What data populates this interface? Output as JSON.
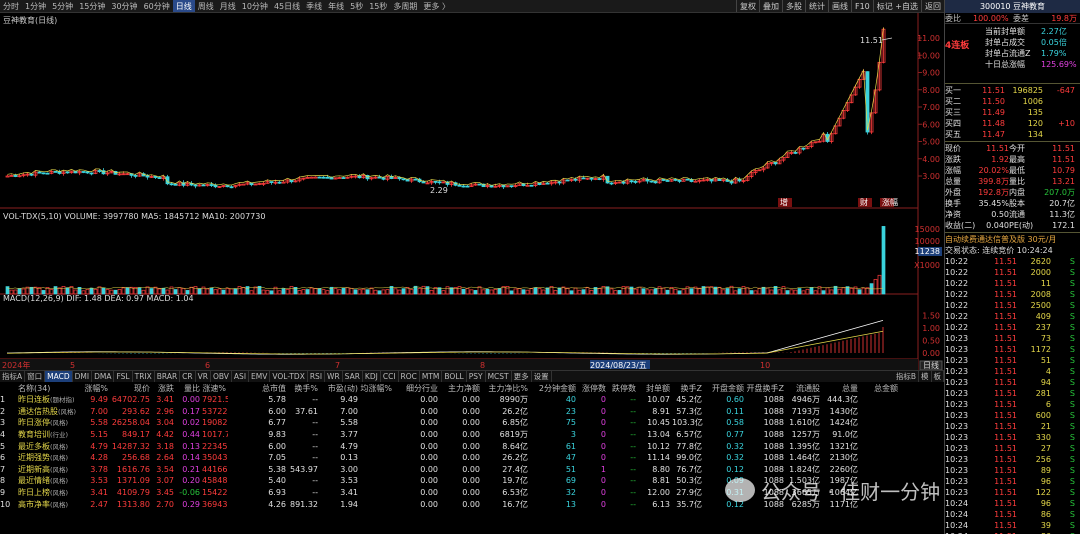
{
  "topbar": {
    "periods": [
      "分时",
      "1分钟",
      "5分钟",
      "15分钟",
      "30分钟",
      "60分钟",
      "日线",
      "周线",
      "月线",
      "10分钟",
      "45日线",
      "季线",
      "年线",
      "5秒",
      "15秒",
      "多周期",
      "更多 〉"
    ],
    "selected": "日线",
    "right": [
      "复权",
      "叠加",
      "多股",
      "统计",
      "画线",
      "F10",
      "标记 +自选",
      "返回"
    ]
  },
  "chart": {
    "title": "豆神教育(日线)",
    "price_axis": [
      "11.00",
      "10.00",
      "9.00",
      "8.00",
      "7.00",
      "6.00",
      "5.00",
      "4.00",
      "3.00"
    ],
    "high_label": "11.51",
    "low_label": "2.29",
    "markers": [
      "增",
      "财",
      "涨幅"
    ],
    "vol_title": "VOL-TDX(5,10) VOLUME: 3997780 MA5: 1845712 MA10: 2007730",
    "vol_axis": [
      "15000",
      "10000",
      "5000",
      "X1000"
    ],
    "vol_last": "11238",
    "macd_title": "MACD(12,26,9) DIF: 1.48 DEA: 0.97 MACD: 1.04",
    "macd_axis": [
      "1.50",
      "1.00",
      "0.50",
      "0.00"
    ],
    "date_axis": [
      "2024年",
      "5",
      "6",
      "7",
      "8",
      "9",
      "2024/08/23/五",
      "10"
    ],
    "side_tab": "日线"
  },
  "tabs": {
    "items": [
      "指标A",
      "窗口",
      "MACD",
      "DMI",
      "DMA",
      "FSL",
      "TRIX",
      "BRAR",
      "CR",
      "VR",
      "OBV",
      "ASI",
      "EMV",
      "VOL-TDX",
      "RSI",
      "WR",
      "SAR",
      "KDJ",
      "CCI",
      "ROC",
      "MTM",
      "BOLL",
      "PSY",
      "MCST",
      "更多",
      "设置"
    ],
    "selected": "MACD",
    "right": [
      "指标B",
      "模",
      "板"
    ]
  },
  "table": {
    "headers": [
      "",
      "名称(34)",
      "涨幅%",
      "现价",
      "涨跌",
      "量比",
      "涨速%",
      "总市值",
      "换手%",
      "市盈(动)",
      "均涨幅%",
      "细分行业",
      "主力净额",
      "主力净比%",
      "2分钟金额",
      "涨停数",
      "跌停数",
      "封单额",
      "换手Z",
      "开盘金额",
      "开盘换手Z",
      "流通股",
      "总量",
      "总金额"
    ],
    "rows": [
      [
        "1",
        "昨日连板",
        "(题材指)",
        "9.49",
        "64702.75",
        "3.41",
        "0.00",
        "7921.56亿",
        "5.78",
        "--",
        "9.49",
        "",
        "0.00",
        "0.00",
        "8990万",
        "40",
        "0",
        "--",
        "10.07",
        "45.2亿",
        "0.60",
        "1088",
        "4946万",
        "444.3亿"
      ],
      [
        "2",
        "通达信热股",
        "(风格)",
        "7.00",
        "293.62",
        "2.96",
        "0.17",
        "53722.25亿",
        "6.00",
        "37.61",
        "7.00",
        "",
        "0.00",
        "0.00",
        "26.2亿",
        "23",
        "0",
        "--",
        "8.91",
        "57.3亿",
        "0.11",
        "1088",
        "7193万",
        "1430亿"
      ],
      [
        "3",
        "昨日涨停",
        "(风格)",
        "5.58",
        "26258.04",
        "3.04",
        "0.02",
        "19082.38亿",
        "6.77",
        "--",
        "5.58",
        "",
        "0.00",
        "0.00",
        "6.85亿",
        "75",
        "0",
        "--",
        "10.45",
        "103.3亿",
        "0.58",
        "1088",
        "1.610亿",
        "1424亿"
      ],
      [
        "4",
        "教育培训",
        "(行业)",
        "5.15",
        "849.17",
        "4.42",
        "0.44",
        "1017.75亿",
        "9.83",
        "--",
        "3.77",
        "",
        "0.00",
        "0.00",
        "6819万",
        "3",
        "0",
        "--",
        "13.04",
        "6.57亿",
        "0.77",
        "1088",
        "1257万",
        "91.0亿"
      ],
      [
        "5",
        "最近多板",
        "(风格)",
        "4.79",
        "14287.32",
        "3.18",
        "0.13",
        "22345.18亿",
        "6.00",
        "--",
        "4.79",
        "",
        "0.00",
        "0.00",
        "8.64亿",
        "61",
        "0",
        "--",
        "10.12",
        "77.8亿",
        "0.32",
        "1088",
        "1.395亿",
        "1321亿"
      ],
      [
        "6",
        "近期强势",
        "(风格)",
        "4.28",
        "256.68",
        "2.64",
        "0.14",
        "35043.06亿",
        "7.05",
        "--",
        "0.13",
        "",
        "0.00",
        "0.00",
        "26.2亿",
        "47",
        "0",
        "--",
        "11.14",
        "99.0亿",
        "0.32",
        "1088",
        "1.464亿",
        "2130亿"
      ],
      [
        "7",
        "近期新高",
        "(风格)",
        "3.78",
        "1616.76",
        "3.54",
        "0.21",
        "44166.50亿",
        "5.38",
        "543.97",
        "3.00",
        "",
        "0.00",
        "0.00",
        "27.4亿",
        "51",
        "1",
        "--",
        "8.80",
        "76.7亿",
        "0.12",
        "1088",
        "1.824亿",
        "2260亿"
      ],
      [
        "8",
        "最近情绪",
        "(风格)",
        "3.53",
        "1371.09",
        "3.07",
        "0.20",
        "45848.64亿",
        "5.40",
        "--",
        "3.53",
        "",
        "0.00",
        "0.00",
        "19.7亿",
        "69",
        "0",
        "--",
        "8.81",
        "50.3亿",
        "0.09",
        "1088",
        "1.503亿",
        "1987亿"
      ],
      [
        "9",
        "昨日上榜",
        "(风格)",
        "3.41",
        "4109.79",
        "3.45",
        "-0.06",
        "15422.33亿",
        "6.93",
        "--",
        "3.41",
        "",
        "0.00",
        "0.00",
        "6.53亿",
        "32",
        "0",
        "--",
        "12.00",
        "27.9亿",
        "0.31",
        "1088",
        "3665万",
        "1064亿"
      ],
      [
        "10",
        "高市净率",
        "(风格)",
        "2.47",
        "1313.80",
        "2.70",
        "0.29",
        "36943.53亿",
        "4.26",
        "891.32",
        "1.94",
        "",
        "0.00",
        "0.00",
        "16.7亿",
        "13",
        "0",
        "--",
        "6.13",
        "35.7亿",
        "0.12",
        "1088",
        "6285万",
        "1171亿"
      ]
    ]
  },
  "right": {
    "code_name": "300010 豆神教育",
    "weibi_label": "委比",
    "weibi_val": "100.00%",
    "weicha_label": "委差",
    "weicha_val": "19.8万",
    "board": "4连板",
    "seal": [
      [
        "当前封单额",
        "2.27亿"
      ],
      [
        "封单占成交",
        "0.05倍"
      ],
      [
        "封单占流通Z",
        "1.79%"
      ],
      [
        "十日总涨幅",
        "125.69%"
      ]
    ],
    "book": [
      [
        "买一",
        "11.51",
        "196825",
        "-647"
      ],
      [
        "买二",
        "11.50",
        "1006",
        ""
      ],
      [
        "买三",
        "11.49",
        "135",
        ""
      ],
      [
        "买四",
        "11.48",
        "120",
        "+10"
      ],
      [
        "买五",
        "11.47",
        "134",
        ""
      ]
    ],
    "quote": [
      [
        "现价",
        "11.51",
        "今开",
        "11.51"
      ],
      [
        "涨跌",
        "1.92",
        "最高",
        "11.51"
      ],
      [
        "涨幅",
        "20.02%",
        "最低",
        "10.79"
      ],
      [
        "总量",
        "399.8万",
        "量比",
        "13.21"
      ],
      [
        "外盘",
        "192.8万",
        "内盘",
        "207.0万"
      ],
      [
        "换手",
        "35.45%",
        "股本",
        "20.7亿"
      ],
      [
        "净资",
        "0.50",
        "流通",
        "11.3亿"
      ],
      [
        "收益(二)",
        "0.040",
        "PE(动)",
        "172.1"
      ]
    ],
    "auto_line": "自动续费通达信普及版 30元/月",
    "trade_status": "交易状态: 连续竞价 10:24:24",
    "ticks": [
      [
        "10:22",
        "11.51",
        "2620",
        "S"
      ],
      [
        "10:22",
        "11.51",
        "2000",
        "S"
      ],
      [
        "10:22",
        "11.51",
        "11",
        "S"
      ],
      [
        "10:22",
        "11.51",
        "2008",
        "S"
      ],
      [
        "10:22",
        "11.51",
        "2500",
        "S"
      ],
      [
        "10:22",
        "11.51",
        "409",
        "S"
      ],
      [
        "10:22",
        "11.51",
        "237",
        "S"
      ],
      [
        "10:23",
        "11.51",
        "73",
        "S"
      ],
      [
        "10:23",
        "11.51",
        "1172",
        "S"
      ],
      [
        "10:23",
        "11.51",
        "51",
        "S"
      ],
      [
        "10:23",
        "11.51",
        "4",
        "S"
      ],
      [
        "10:23",
        "11.51",
        "94",
        "S"
      ],
      [
        "10:23",
        "11.51",
        "281",
        "S"
      ],
      [
        "10:23",
        "11.51",
        "6",
        "S"
      ],
      [
        "10:23",
        "11.51",
        "600",
        "S"
      ],
      [
        "10:23",
        "11.51",
        "21",
        "S"
      ],
      [
        "10:23",
        "11.51",
        "330",
        "S"
      ],
      [
        "10:23",
        "11.51",
        "27",
        "S"
      ],
      [
        "10:23",
        "11.51",
        "256",
        "S"
      ],
      [
        "10:23",
        "11.51",
        "89",
        "S"
      ],
      [
        "10:23",
        "11.51",
        "96",
        "S"
      ],
      [
        "10:23",
        "11.51",
        "122",
        "S"
      ],
      [
        "10:24",
        "11.51",
        "96",
        "S"
      ],
      [
        "10:24",
        "11.51",
        "86",
        "S"
      ],
      [
        "10:24",
        "11.51",
        "39",
        "S"
      ],
      [
        "10:24",
        "11.51",
        "86",
        "S"
      ]
    ]
  },
  "watermark": "公众号 · 佳财一分钟",
  "colors": {
    "up": "#ff3c3c",
    "down": "#27c43a",
    "flat": "#e0e0e0",
    "accent": "#1c3f7a"
  }
}
